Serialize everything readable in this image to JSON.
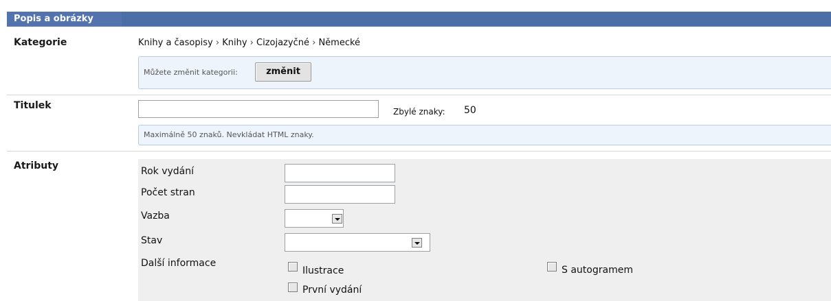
{
  "section": {
    "title": "Popis a obrázky"
  },
  "category": {
    "label": "Kategorie",
    "breadcrumb": [
      "Knihy a časopisy",
      "Knihy",
      "Cizojazyčné",
      "Německé"
    ],
    "separator": "›",
    "hint": "Můžete změnit kategorii:",
    "change_button": "změnit"
  },
  "title_field": {
    "label": "Titulek",
    "value": "",
    "remaining_label": "Zbylé znaky:",
    "remaining_value": "50",
    "hint": "Maximálně 50 znaků. Nevkládat HTML znaky."
  },
  "attributes": {
    "label": "Atributy",
    "year": {
      "label": "Rok vydání",
      "value": ""
    },
    "pages": {
      "label": "Počet stran",
      "value": ""
    },
    "binding": {
      "label": "Vazba",
      "value": ""
    },
    "condition": {
      "label": "Stav",
      "value": ""
    },
    "more_info": {
      "label": "Další informace",
      "options": [
        {
          "label": "Ilustrace",
          "checked": false
        },
        {
          "label": "První vydání",
          "checked": false
        },
        {
          "label": "S autogramem",
          "checked": false
        }
      ]
    }
  },
  "colors": {
    "header_bg": "#4b6ea7",
    "info_bg": "#edf4fb",
    "info_border": "#b7cbe6",
    "attr_panel_bg": "#efefef"
  }
}
